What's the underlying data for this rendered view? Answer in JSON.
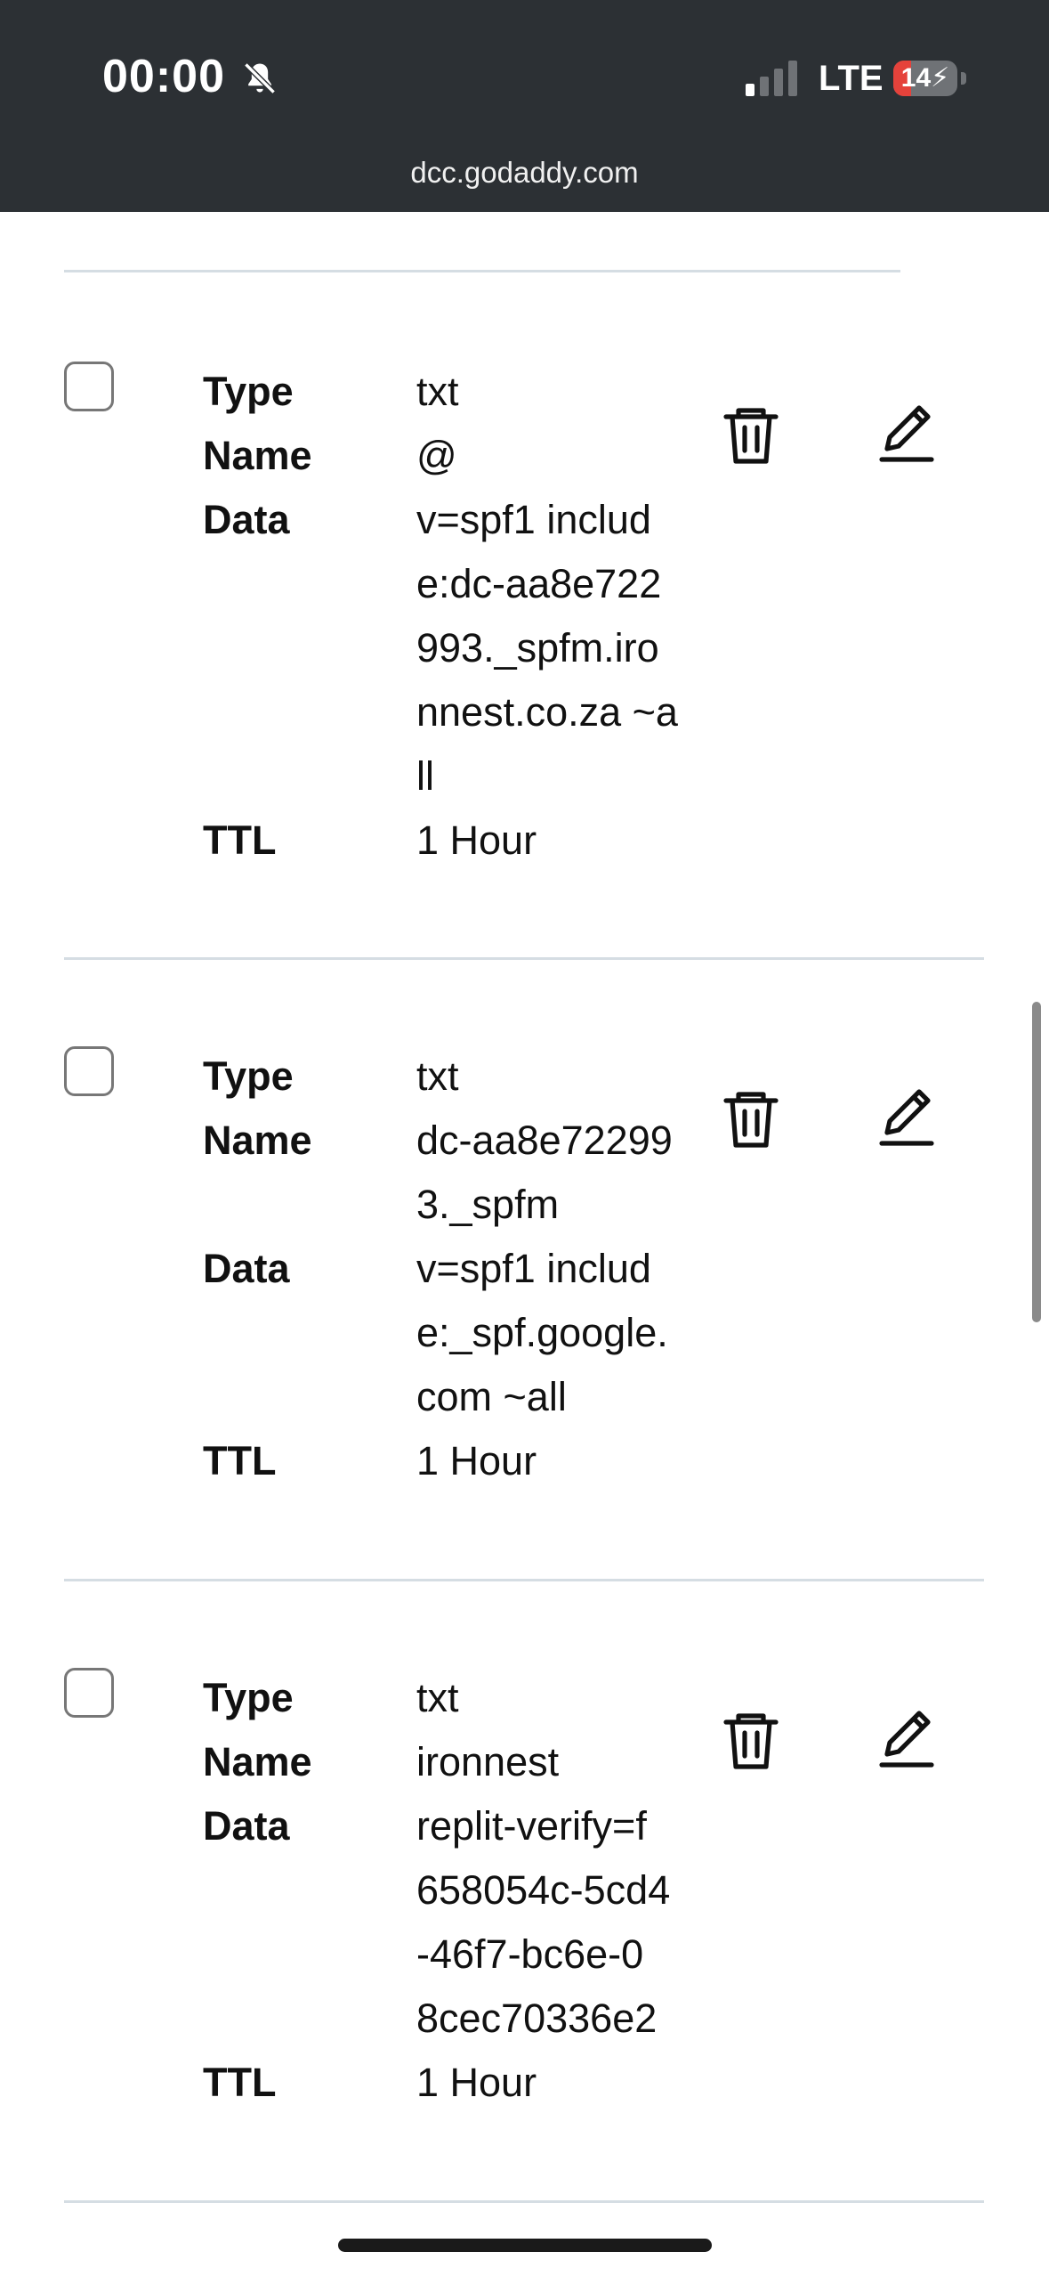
{
  "status_bar": {
    "time": "00:00",
    "network": "LTE",
    "battery_level": "14",
    "battery_fraction": 0.14
  },
  "browser": {
    "url": "dcc.godaddy.com"
  },
  "labels": {
    "type": "Type",
    "name": "Name",
    "data": "Data",
    "ttl": "TTL"
  },
  "records": [
    {
      "type": "txt",
      "name": "@",
      "data": "v=spf1 includ\ne:dc-aa8e722\n993._spfm.iro\nnnest.co.za ~a\nll",
      "ttl": "1 Hour"
    },
    {
      "type": "txt",
      "name": "dc-aa8e72299\n3._spfm",
      "data": "v=spf1 includ\ne:_spf.google.\ncom ~all",
      "ttl": "1 Hour"
    },
    {
      "type": "txt",
      "name": "ironnest",
      "data": "replit-verify=f\n658054c-5cd4\n-46f7-bc6e-0\n8cec70336e2",
      "ttl": "1 Hour"
    }
  ],
  "icons": {
    "delete": "trash-icon",
    "edit": "pencil-icon",
    "muted": "bell-slash-icon",
    "signal": "signal-icon",
    "battery": "battery-charging-icon"
  },
  "colors": {
    "status_bar_bg": "#2c3034",
    "divider": "#d5dde3",
    "battery_low": "#e5423b"
  }
}
